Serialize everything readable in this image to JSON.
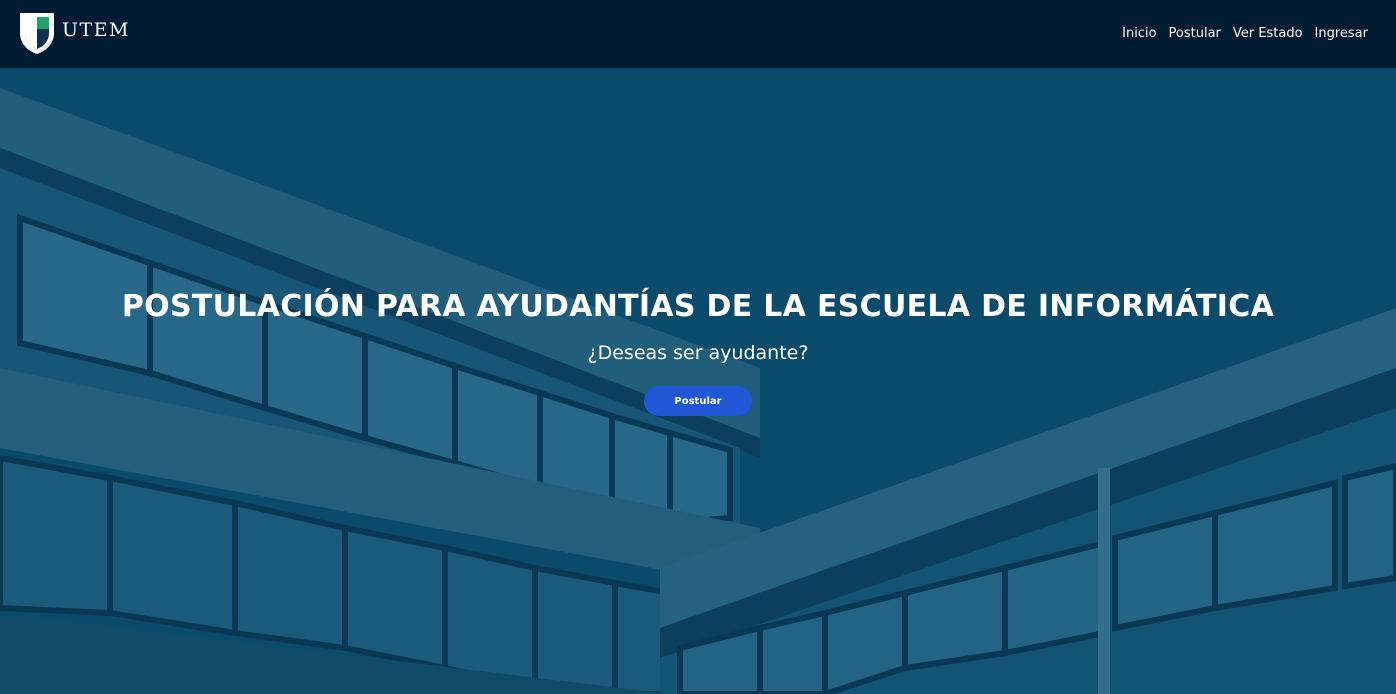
{
  "brand": {
    "name": "UTEM",
    "logo_icon": "utem-shield-logo-icon"
  },
  "nav": {
    "items": [
      {
        "label": "Inicio"
      },
      {
        "label": "Postular"
      },
      {
        "label": "Ver Estado"
      },
      {
        "label": "Ingresar"
      }
    ]
  },
  "hero": {
    "title": "POSTULACIÓN PARA AYUDANTÍAS DE LA ESCUELA DE INFORMÁTICA",
    "subtitle": "¿Deseas ser ayudante?",
    "button_label": "Postular",
    "background_image": "building-windows-photo"
  },
  "colors": {
    "navbar": "#011b33",
    "hero_tint": "#0a4f6e",
    "button": "#2156d6",
    "logo_green": "#1fa268",
    "logo_navy": "#0b2f55"
  }
}
